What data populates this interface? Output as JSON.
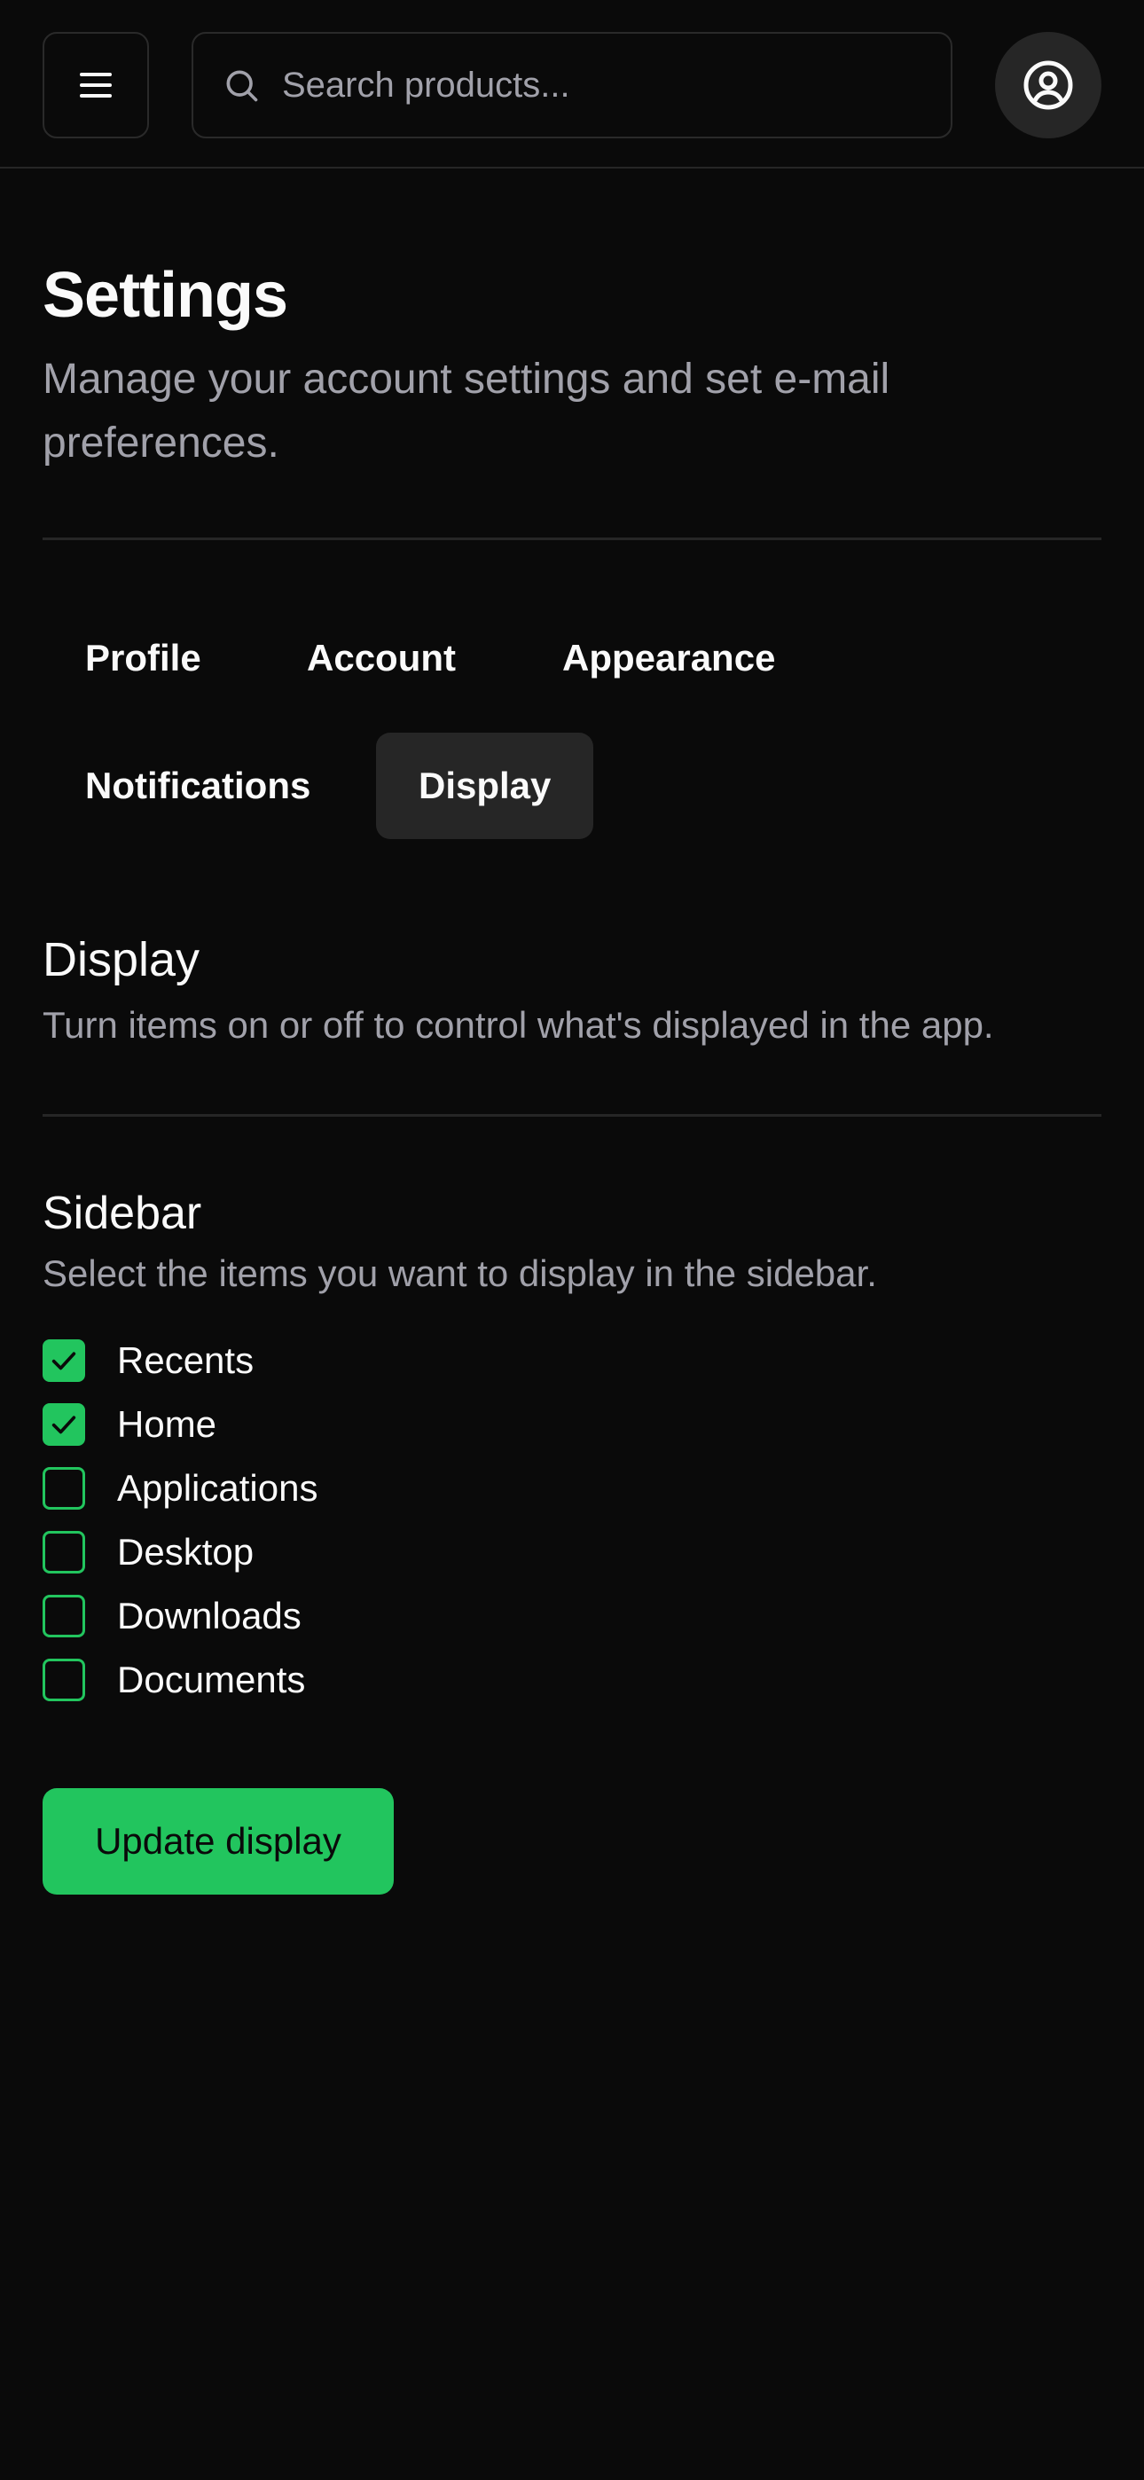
{
  "header": {
    "menu_icon": "hamburger-menu-icon",
    "search_icon": "search-icon",
    "search_placeholder": "Search products...",
    "search_value": "",
    "avatar_icon": "user-circle-icon"
  },
  "page": {
    "title": "Settings",
    "subtitle": "Manage your account settings and set e-mail preferences."
  },
  "tabs": [
    {
      "label": "Profile",
      "active": false
    },
    {
      "label": "Account",
      "active": false
    },
    {
      "label": "Appearance",
      "active": false
    },
    {
      "label": "Notifications",
      "active": false
    },
    {
      "label": "Display",
      "active": true
    }
  ],
  "display": {
    "title": "Display",
    "description": "Turn items on or off to control what's displayed in the app."
  },
  "sidebar": {
    "title": "Sidebar",
    "description": "Select the items you want to display in the sidebar.",
    "items": [
      {
        "label": "Recents",
        "checked": true
      },
      {
        "label": "Home",
        "checked": true
      },
      {
        "label": "Applications",
        "checked": false
      },
      {
        "label": "Desktop",
        "checked": false
      },
      {
        "label": "Downloads",
        "checked": false
      },
      {
        "label": "Documents",
        "checked": false
      }
    ]
  },
  "actions": {
    "update_label": "Update display"
  },
  "colors": {
    "background": "#0a0a0a",
    "accent": "#22c55e",
    "muted_text": "#a1a1aa",
    "border": "#262626"
  }
}
